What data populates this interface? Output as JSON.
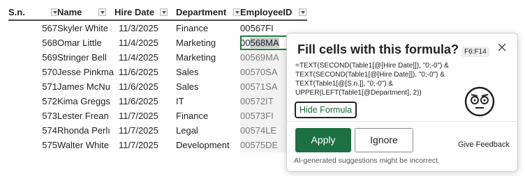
{
  "sheet": {
    "headers": {
      "sn": "S.n.",
      "name": "Name",
      "hire_date": "Hire Date",
      "department": "Department",
      "employee_id": "EmployeeID"
    },
    "rows": [
      {
        "sn": "567",
        "name": "Skyler White",
        "hire_date": "11/3/2025",
        "department": "Finance",
        "employee_id": "00567FI"
      },
      {
        "sn": "568",
        "name": "Omar Little",
        "hire_date": "11/4/2025",
        "department": "Marketing",
        "employee_id_pre": "00",
        "employee_id_sel": "568MA"
      },
      {
        "sn": "569",
        "name": "Stringer Bell",
        "hire_date": "11/4/2025",
        "department": "Marketing",
        "employee_id": "00569MA"
      },
      {
        "sn": "570",
        "name": "Jesse Pinkma",
        "hire_date": "11/6/2025",
        "department": "Sales",
        "employee_id": "00570SA"
      },
      {
        "sn": "571",
        "name": "James McNu",
        "hire_date": "11/6/2025",
        "department": "Sales",
        "employee_id": "00571SA"
      },
      {
        "sn": "572",
        "name": "Kima Greggs",
        "hire_date": "11/6/2025",
        "department": "IT",
        "employee_id": "00572IT"
      },
      {
        "sn": "573",
        "name": "Lester Frean",
        "hire_date": "11/7/2025",
        "department": "Finance",
        "employee_id": "00573FI"
      },
      {
        "sn": "574",
        "name": "Rhonda Perlı",
        "hire_date": "11/7/2025",
        "department": "Legal",
        "employee_id": "00574LE"
      },
      {
        "sn": "575",
        "name": "Walter White",
        "hire_date": "11/7/2025",
        "department": "Development",
        "employee_id": "00575DE"
      }
    ]
  },
  "popup": {
    "title": "Fill cells with this formula?",
    "range": "F6:F14",
    "formula_lines": [
      "=TEXT(SECOND(Table1[@[Hire Date]]), \"0;-0\") &",
      "TEXT(SECOND(Table1[@[Hire Date]]), \"0;-0\") &",
      "TEXT(Table1[@[S.n.]], \"0;-0\") &",
      "UPPER(LEFT(Table1[@Department], 2))"
    ],
    "hide_formula_label": "Hide Formula",
    "apply_label": "Apply",
    "ignore_label": "Ignore",
    "feedback_label": "Give Feedback",
    "disclaimer": "AI-generated suggestions might be incorrect",
    "icons": [
      "close-icon",
      "face-icon"
    ]
  },
  "colors": {
    "accent_green": "#1d7044",
    "ghost_text": "#7b7b7b"
  }
}
